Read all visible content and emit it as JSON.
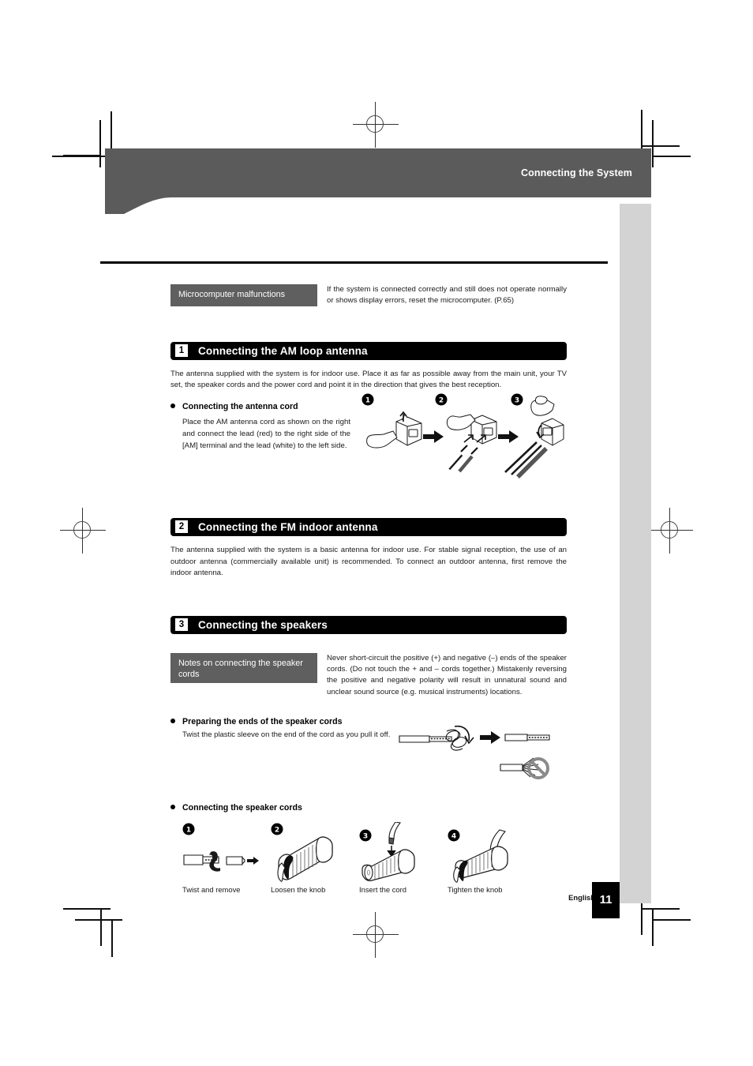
{
  "header": {
    "title": "Connecting the System"
  },
  "callout_microcomputer": {
    "label": "Microcomputer malfunctions",
    "body": "If the system is connected correctly and still does not operate normally or shows display errors, reset the microcomputer. (P.65)"
  },
  "sections": [
    {
      "number": "1",
      "title": "Connecting the AM loop antenna",
      "para": "The antenna supplied with the system is for indoor use. Place it as far as possible away from the main unit, your TV set, the speaker cords and the power cord and point it in the direction that gives the best reception.",
      "bullet_title": "Connecting the antenna cord",
      "bullet_body": "Place the AM antenna cord as shown on the right and connect the lead (red) to the right side of the [AM] terminal and the lead (white) to the left side.",
      "figure_steps": [
        "1",
        "2",
        "3"
      ]
    },
    {
      "number": "2",
      "title": "Connecting the FM indoor antenna",
      "para": "The antenna supplied with the system is a basic antenna for indoor use. For stable signal reception, the use of an outdoor antenna (commercially available unit) is recommended. To connect an outdoor antenna, first remove the indoor antenna."
    },
    {
      "number": "3",
      "title": "Connecting the speakers"
    }
  ],
  "callout_speaker_notes": {
    "label": "Notes on connecting the speaker cords",
    "body": "Never short-circuit the positive (+) and negative (–) ends of the speaker cords. (Do not touch the + and – cords together.) Mistakenly reversing the positive and negative polarity will result in unnatural sound and unclear sound source (e.g. musical instruments) locations."
  },
  "preparing_ends": {
    "bullet_title": "Preparing the ends of the speaker cords",
    "body": "Twist the plastic sleeve on the end of the cord as you pull it off."
  },
  "connecting_cords": {
    "bullet_title": "Connecting the speaker cords",
    "steps": [
      {
        "number": "1",
        "caption": "Twist and remove"
      },
      {
        "number": "2",
        "caption": "Loosen the knob"
      },
      {
        "number": "3",
        "caption": "Insert the cord"
      },
      {
        "number": "4",
        "caption": "Tighten the knob"
      }
    ]
  },
  "footer": {
    "language": "English",
    "page_number": "11"
  },
  "colors": {
    "header_band": "#5b5b5b",
    "callout_label": "#5f5f5f",
    "section_bar": "#000000",
    "sidebar": "#d3d3d3",
    "page_box": "#000000"
  }
}
